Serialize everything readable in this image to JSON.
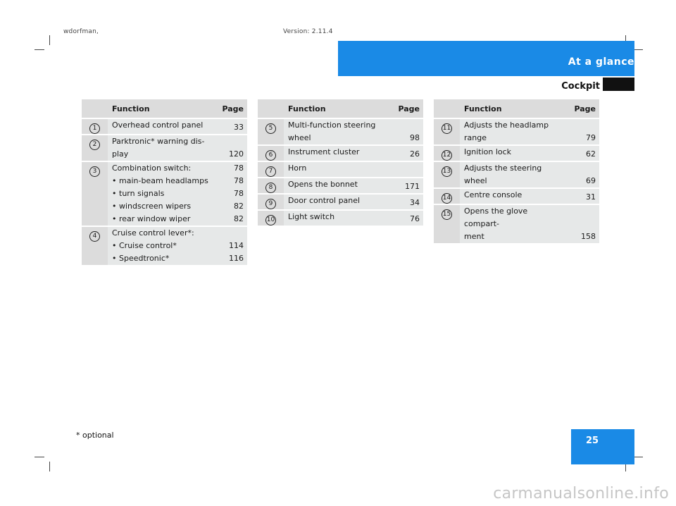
{
  "header": {
    "meta_left": "wdorfman,",
    "meta_right": "Version: 2.11.4",
    "section_title": "At a glance",
    "subtitle": "Cockpit"
  },
  "columns": {
    "function": "Function",
    "page": "Page"
  },
  "table1": [
    {
      "num": "1",
      "lines": [
        "Overhead control panel"
      ],
      "pages": [
        "33"
      ]
    },
    {
      "num": "2",
      "lines": [
        "Parktronic* warning dis-",
        "play"
      ],
      "pages": [
        "120"
      ]
    },
    {
      "num": "3",
      "lines": [
        "Combination switch:",
        "main-beam headlamps",
        "turn signals",
        "windscreen wipers",
        "rear window wiper"
      ],
      "pages": [
        "78",
        "78",
        "78",
        "82",
        "82"
      ]
    },
    {
      "num": "4",
      "lines": [
        "Cruise control lever*:",
        "Cruise control*",
        "Speedtronic*"
      ],
      "pages": [
        "114",
        "116"
      ]
    }
  ],
  "table2": [
    {
      "num": "5",
      "lines": [
        "Multi-function steering",
        "wheel"
      ],
      "pages": [
        "98"
      ]
    },
    {
      "num": "6",
      "lines": [
        "Instrument cluster"
      ],
      "pages": [
        "26"
      ]
    },
    {
      "num": "7",
      "lines": [
        "Horn"
      ],
      "pages": [
        ""
      ]
    },
    {
      "num": "8",
      "lines": [
        "Opens the bonnet"
      ],
      "pages": [
        "171"
      ]
    },
    {
      "num": "9",
      "lines": [
        "Door control panel"
      ],
      "pages": [
        "34"
      ]
    },
    {
      "num": "10",
      "lines": [
        "Light switch"
      ],
      "pages": [
        "76"
      ]
    }
  ],
  "table3": [
    {
      "num": "11",
      "lines": [
        "Adjusts the headlamp",
        "range"
      ],
      "pages": [
        "79"
      ]
    },
    {
      "num": "12",
      "lines": [
        "Ignition lock"
      ],
      "pages": [
        "62"
      ]
    },
    {
      "num": "13",
      "lines": [
        "Adjusts the steering wheel"
      ],
      "pages": [
        "69"
      ]
    },
    {
      "num": "14",
      "lines": [
        "Centre console"
      ],
      "pages": [
        "31"
      ]
    },
    {
      "num": "15",
      "lines": [
        "Opens the glove compart-",
        "ment"
      ],
      "pages": [
        "158"
      ]
    }
  ],
  "footer": {
    "optional_note": "* optional",
    "page_number": "25",
    "watermark": "carmanualsonline.info"
  },
  "colors": {
    "accent_blue": "#1a8ae6",
    "header_gray": "#dcdcdc",
    "row_gray": "#e6e8e8"
  }
}
